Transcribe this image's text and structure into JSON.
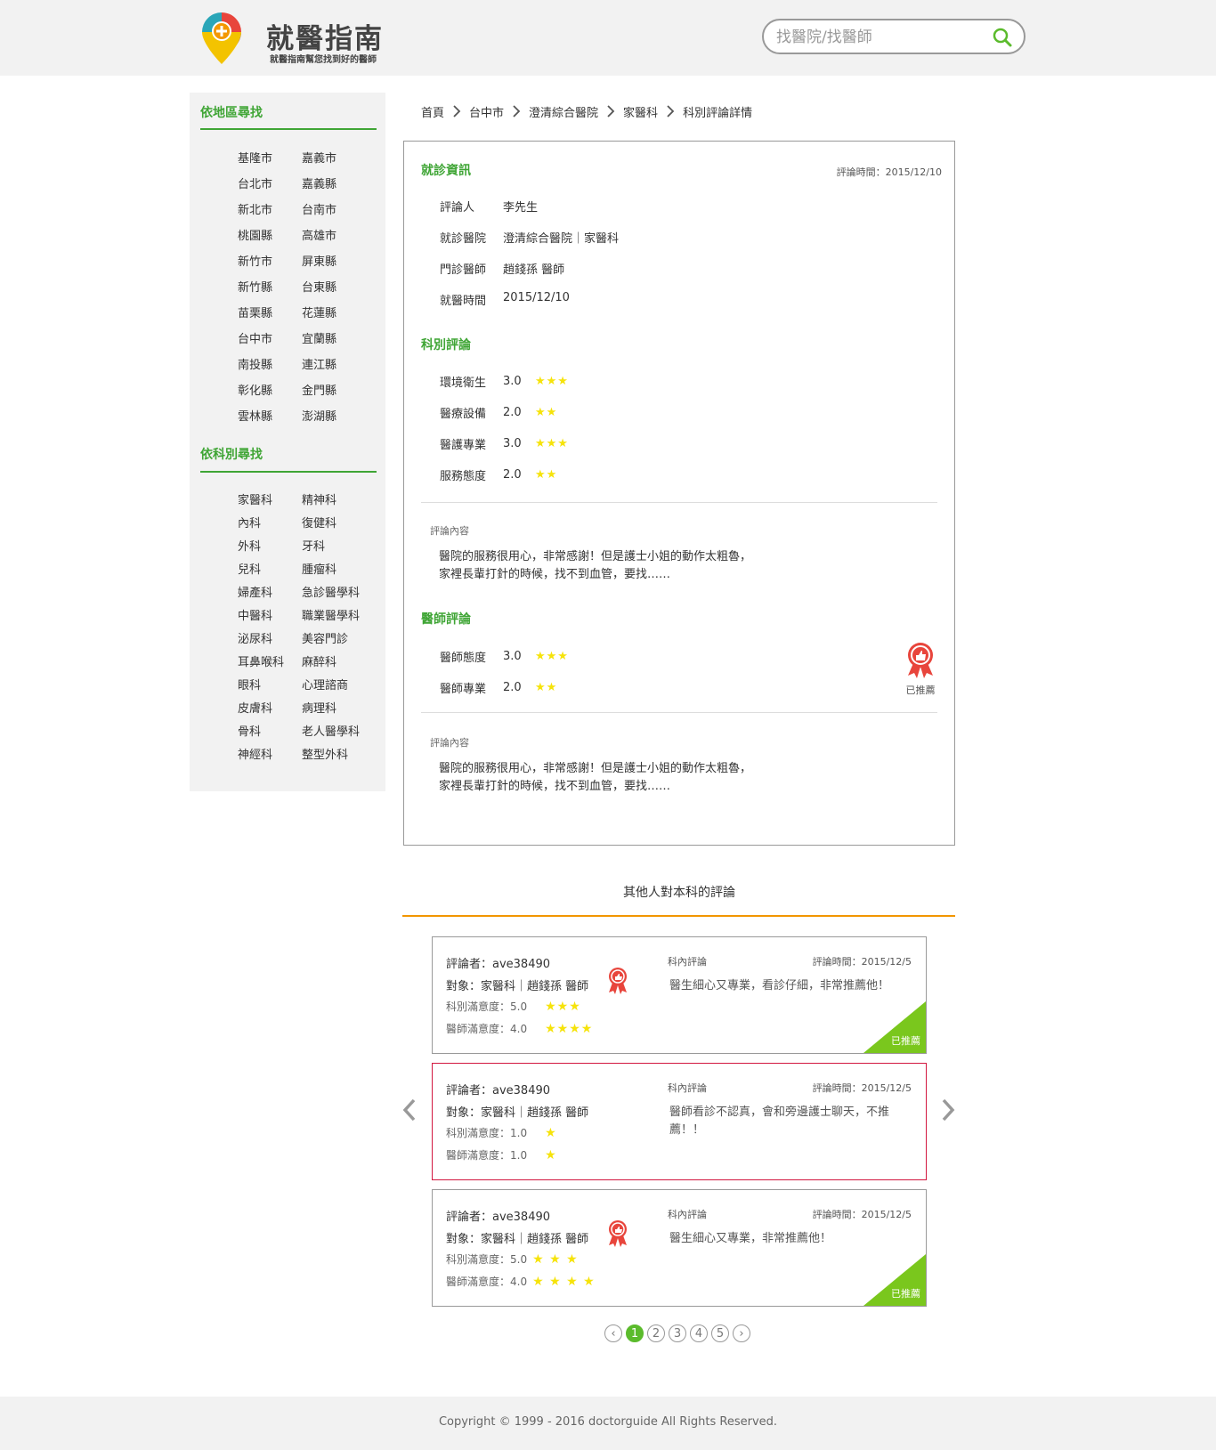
{
  "header": {
    "brand_title": "就醫指南",
    "brand_subtitle": "就醫指南幫您找到好的醫師",
    "search_placeholder": "找醫院/找醫師"
  },
  "sidebar": {
    "region_title": "依地區尋找",
    "regions": [
      "基隆市",
      "嘉義市",
      "台北市",
      "嘉義縣",
      "新北市",
      "台南市",
      "桃園縣",
      "高雄市",
      "新竹市",
      "屏東縣",
      "新竹縣",
      "台東縣",
      "苗栗縣",
      "花蓮縣",
      "台中市",
      "宜蘭縣",
      "南投縣",
      "連江縣",
      "彰化縣",
      "金門縣",
      "雲林縣",
      "澎湖縣"
    ],
    "dept_title": "依科別尋找",
    "depts": [
      "家醫科",
      "精神科",
      "內科",
      "復健科",
      "外科",
      "牙科",
      "兒科",
      "腫瘤科",
      "婦產科",
      "急診醫學科",
      "中醫科",
      "職業醫學科",
      "泌尿科",
      "美容門診",
      "耳鼻喉科",
      "麻醉科",
      "眼科",
      "心理諮商",
      "皮膚科",
      "病理科",
      "骨科",
      "老人醫學科",
      "神經科",
      "整型外科"
    ]
  },
  "breadcrumb": [
    "首頁",
    "台中市",
    "澄清綜合醫院",
    "家醫科",
    "科別評論詳情"
  ],
  "detail": {
    "visit_title": "就診資訊",
    "review_time": "評論時間：2015/12/10",
    "visit_rows": [
      {
        "label": "評論人",
        "value": "李先生"
      },
      {
        "label": "就診醫院",
        "value": "澄清綜合醫院｜家醫科"
      },
      {
        "label": "門診醫師",
        "value": "趙錢孫 醫師"
      },
      {
        "label": "就醫時間",
        "value": "2015/12/10"
      }
    ],
    "dept_title": "科別評論",
    "dept_ratings": [
      {
        "label": "環境衛生",
        "value": "3.0",
        "stars": "★★★"
      },
      {
        "label": "醫療設備",
        "value": "2.0",
        "stars": "★★"
      },
      {
        "label": "醫護專業",
        "value": "3.0",
        "stars": "★★★"
      },
      {
        "label": "服務態度",
        "value": "2.0",
        "stars": "★★"
      }
    ],
    "dept_content_label": "評論內容",
    "dept_content": "醫院的服務很用心，非常感謝！但是護士小姐的動作太粗魯，家裡長輩打針的時候，找不到血管，要找……",
    "doctor_title": "醫師評論",
    "doctor_ratings": [
      {
        "label": "醫師態度",
        "value": "3.0",
        "stars": "★★★"
      },
      {
        "label": "醫師專業",
        "value": "2.0",
        "stars": "★★"
      }
    ],
    "recommended": "已推薦",
    "doctor_content_label": "評論內容",
    "doctor_content": "醫院的服務很用心，非常感謝！但是護士小姐的動作太粗魯，家裡長輩打針的時候，找不到血管，要找……"
  },
  "others": {
    "title": "其他人對本科的評論",
    "cards": [
      {
        "reviewer": "評論者：ave38490",
        "target": "對象：家醫科｜趙錢孫 醫師",
        "dept_score": "科別滿意度：5.0",
        "dept_stars": "★★★",
        "doc_score": "醫師滿意度：4.0",
        "doc_stars": "★★★★",
        "label": "科內評論",
        "time": "評論時間：2015/12/5",
        "text": "醫生細心又專業，看診仔細，非常推薦他！",
        "recommended": "已推薦"
      },
      {
        "reviewer": "評論者：ave38490",
        "target": "對象：家醫科｜趙錢孫 醫師",
        "dept_score": "科別滿意度：1.0",
        "dept_stars": "★",
        "doc_score": "醫師滿意度：1.0",
        "doc_stars": "★",
        "label": "科內評論",
        "time": "評論時間：2015/12/5",
        "text": "醫師看診不認真，會和旁邊護士聊天，不推薦！！"
      },
      {
        "reviewer": "評論者：ave38490",
        "target": "對象：家醫科｜趙錢孫 醫師",
        "dept_score": "科別滿意度：5.0",
        "dept_stars": "★ ★ ★",
        "doc_score": "醫師滿意度：4.0",
        "doc_stars": "★ ★ ★ ★",
        "label": "科內評論",
        "time": "評論時間：2015/12/5",
        "text": "醫生細心又專業，非常推薦他！",
        "recommended": "已推薦"
      }
    ]
  },
  "pagination": {
    "pages": [
      "1",
      "2",
      "3",
      "4",
      "5"
    ],
    "current": "1",
    "prev_glyph": "‹",
    "next_glyph": "›"
  },
  "footer": {
    "copyright": "Copyright © 1999 - 2016 doctorguide All Rights Reserved."
  },
  "colors": {
    "accent_green": "#3fa535",
    "star_yellow": "#f6e30a",
    "orange_line": "#f29600",
    "highlight_red": "#d2173f",
    "corner_green": "#7ac71d"
  }
}
